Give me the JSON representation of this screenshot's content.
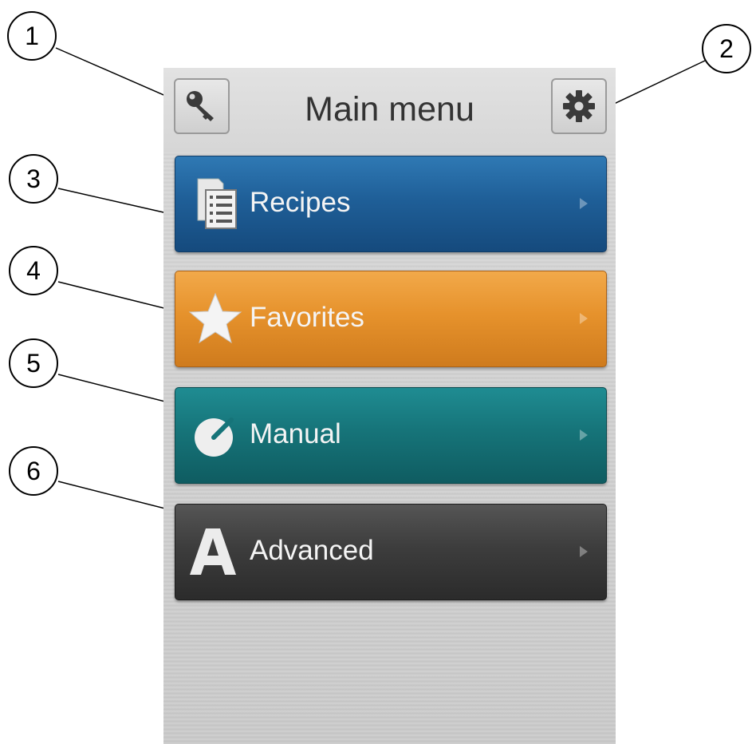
{
  "header": {
    "title": "Main menu",
    "left_icon": "key-icon",
    "right_icon": "gear-icon"
  },
  "menu": [
    {
      "label": "Recipes",
      "icon": "recipe-list-icon",
      "color": "#1f5f98"
    },
    {
      "label": "Favorites",
      "icon": "star-icon",
      "color": "#e6922c"
    },
    {
      "label": "Manual",
      "icon": "dial-icon",
      "color": "#167479"
    },
    {
      "label": "Advanced",
      "icon": "letter-a-icon",
      "color": "#3d3d3d"
    }
  ],
  "callouts": [
    "1",
    "2",
    "3",
    "4",
    "5",
    "6"
  ]
}
